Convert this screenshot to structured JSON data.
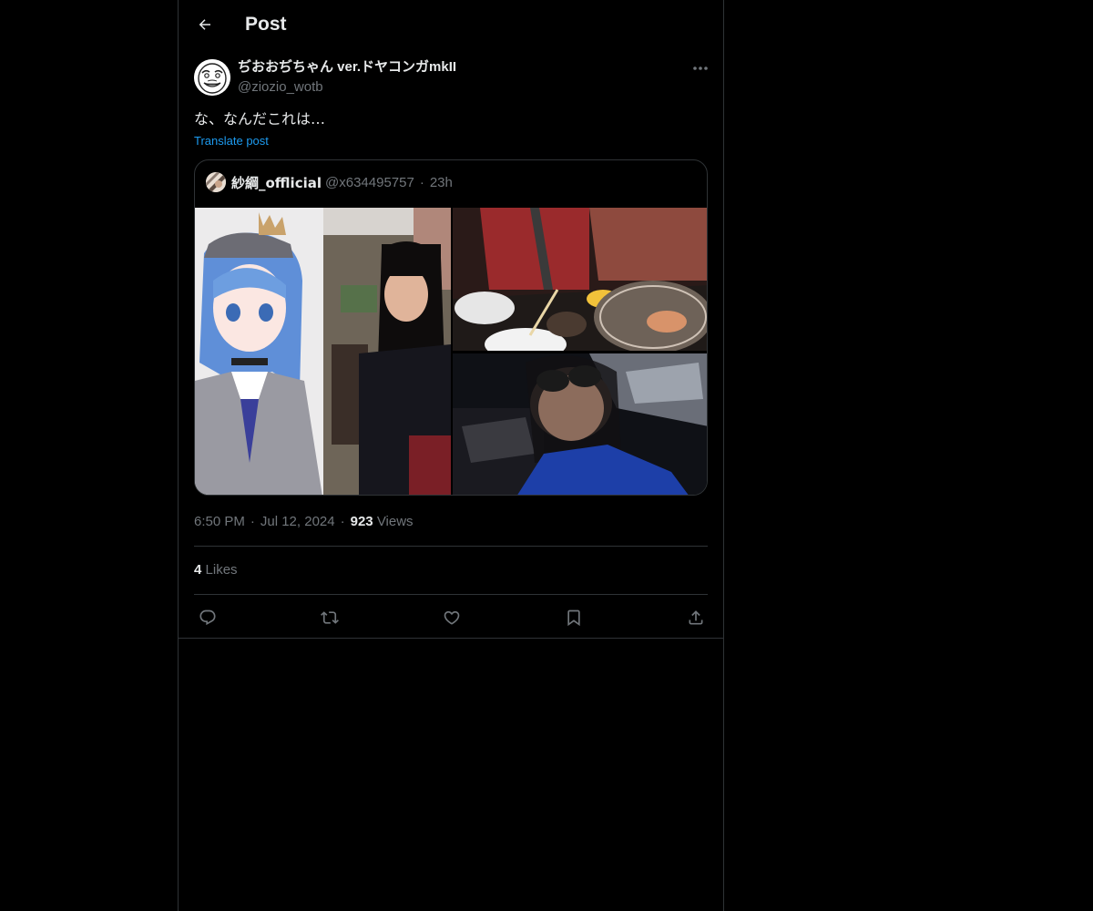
{
  "header": {
    "title": "Post",
    "back_icon": "arrow-left-icon"
  },
  "post": {
    "author_name": "ぢおおぢちゃん ver.ドヤコンガmkII",
    "author_handle": "@ziozio_wotb",
    "avatar_icon": "rage-face-avatar",
    "text": "な、なんだこれは…",
    "translate_label": "Translate post",
    "more_icon": "more-horizontal-icon"
  },
  "quote": {
    "author_name": "紗綱_offlicial",
    "author_handle": "@x634495757",
    "separator": "·",
    "time": "23h",
    "images": [
      "anime-character-with-crown-and-woman-photo",
      "friends-at-yakiniku-grill",
      "woman-in-sunglasses-selfie"
    ]
  },
  "meta": {
    "time": "6:50 PM",
    "separator": "·",
    "date": "Jul 12, 2024",
    "views_count": "923",
    "views_label": "Views"
  },
  "stats": {
    "likes_count": "4",
    "likes_label": "Likes"
  },
  "actions": [
    {
      "name": "reply",
      "icon": "reply-icon"
    },
    {
      "name": "repost",
      "icon": "repost-icon"
    },
    {
      "name": "like",
      "icon": "heart-icon"
    },
    {
      "name": "bookmark",
      "icon": "bookmark-icon"
    },
    {
      "name": "share",
      "icon": "share-icon"
    }
  ],
  "colors": {
    "background": "#000000",
    "text": "#e7e9ea",
    "muted": "#71767b",
    "link": "#1d9bf0",
    "border": "#2f3336"
  }
}
